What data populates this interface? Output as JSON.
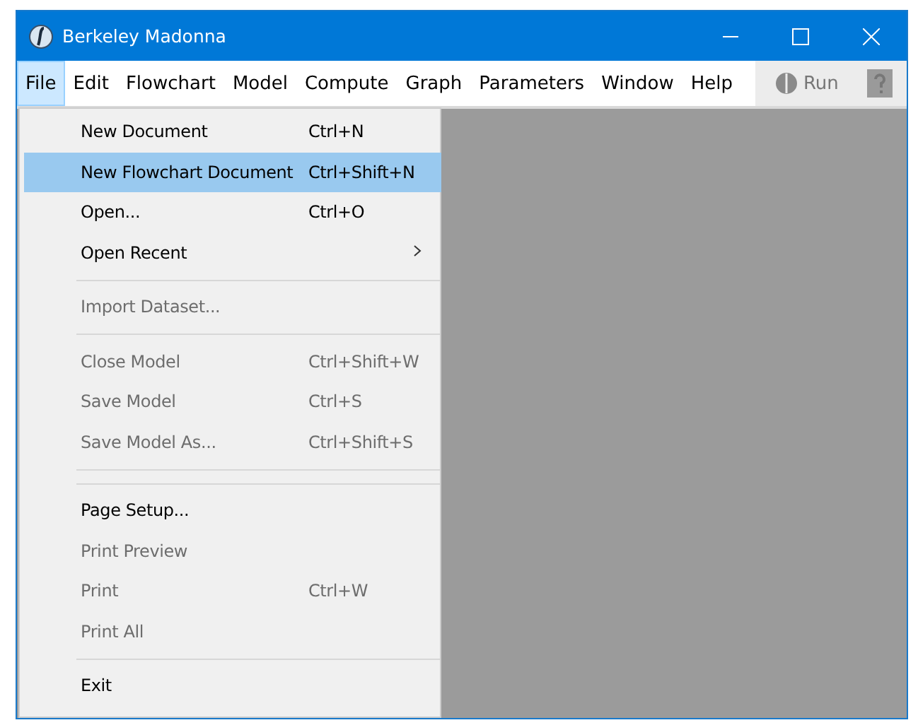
{
  "window": {
    "title": "Berkeley Madonna"
  },
  "menubar": [
    {
      "label": "File",
      "selected": true
    },
    {
      "label": "Edit",
      "selected": false
    },
    {
      "label": "Flowchart",
      "selected": false
    },
    {
      "label": "Model",
      "selected": false
    },
    {
      "label": "Compute",
      "selected": false
    },
    {
      "label": "Graph",
      "selected": false
    },
    {
      "label": "Parameters",
      "selected": false
    },
    {
      "label": "Window",
      "selected": false
    },
    {
      "label": "Help",
      "selected": false
    }
  ],
  "toolbar": {
    "run_button": {
      "label": "Run",
      "disabled": true
    }
  },
  "file_menu": [
    {
      "kind": "item",
      "label": "New Document",
      "shortcut": "Ctrl+N",
      "disabled": false,
      "selected": false
    },
    {
      "kind": "item",
      "label": "New Flowchart Document",
      "shortcut": "Ctrl+Shift+N",
      "disabled": false,
      "selected": true
    },
    {
      "kind": "item",
      "label": "Open...",
      "shortcut": "Ctrl+O",
      "disabled": false,
      "selected": false
    },
    {
      "kind": "item",
      "label": "Open Recent",
      "submenu": true,
      "disabled": false,
      "selected": false
    },
    {
      "kind": "separator"
    },
    {
      "kind": "item",
      "label": "Import Dataset...",
      "disabled": true,
      "selected": false
    },
    {
      "kind": "separator"
    },
    {
      "kind": "item",
      "label": "Close Model",
      "shortcut": "Ctrl+Shift+W",
      "disabled": true,
      "selected": false
    },
    {
      "kind": "item",
      "label": "Save Model",
      "shortcut": "Ctrl+S",
      "disabled": true,
      "selected": false
    },
    {
      "kind": "item",
      "label": "Save Model As...",
      "shortcut": "Ctrl+Shift+S",
      "disabled": true,
      "selected": false
    },
    {
      "kind": "separator"
    },
    {
      "kind": "separator"
    },
    {
      "kind": "item",
      "label": "Page Setup...",
      "disabled": false,
      "selected": false
    },
    {
      "kind": "item",
      "label": "Print Preview",
      "disabled": true,
      "selected": false
    },
    {
      "kind": "item",
      "label": "Print",
      "shortcut": "Ctrl+W",
      "disabled": true,
      "selected": false
    },
    {
      "kind": "item",
      "label": "Print All",
      "disabled": true,
      "selected": false
    },
    {
      "kind": "separator"
    },
    {
      "kind": "item",
      "label": "Exit",
      "disabled": false,
      "selected": false
    }
  ]
}
